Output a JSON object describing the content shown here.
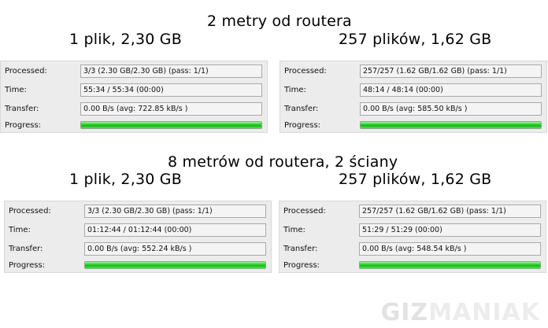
{
  "section_top": {
    "title": "2 metry od routera",
    "left": {
      "caption": "1 plik, 2,30 GB",
      "processed_label": "Processed:",
      "processed": "3/3 (2.30 GB/2.30 GB) (pass: 1/1)",
      "time_label": "Time:",
      "time": "55:34 / 55:34 (00:00)",
      "transfer_label": "Transfer:",
      "transfer": "0.00 B/s (avg: 722.85 kB/s )",
      "progress_label": "Progress:",
      "progress": 1.0
    },
    "right": {
      "caption": "257 plików, 1,62 GB",
      "processed_label": "Processed:",
      "processed": "257/257 (1.62 GB/1.62 GB) (pass: 1/1)",
      "time_label": "Time:",
      "time": "48:14 / 48:14 (00:00)",
      "transfer_label": "Transfer:",
      "transfer": "0.00 B/s (avg: 585.50 kB/s )",
      "progress_label": "Progress:",
      "progress": 1.0
    }
  },
  "section_bottom": {
    "title": "8 metrów od routera, 2 ściany",
    "left": {
      "caption": "1 plik, 2,30 GB",
      "processed_label": "Processed:",
      "processed": "3/3 (2.30 GB/2.30 GB) (pass: 1/1)",
      "time_label": "Time:",
      "time": "01:12:44 / 01:12:44 (00:00)",
      "transfer_label": "Transfer:",
      "transfer": "0.00 B/s (avg: 552.24 kB/s )",
      "progress_label": "Progress:",
      "progress": 1.0
    },
    "right": {
      "caption": "257 plików, 1,62 GB",
      "processed_label": "Processed:",
      "processed": "257/257 (1.62 GB/1.62 GB) (pass: 1/1)",
      "time_label": "Time:",
      "time": "51:29 / 51:29 (00:00)",
      "transfer_label": "Transfer:",
      "transfer": "0.00 B/s (avg: 548.54 kB/s )",
      "progress_label": "Progress:",
      "progress": 1.0
    }
  },
  "watermark": {
    "part1": "GIZ",
    "part2": "MANIAK"
  },
  "colors": {
    "progress_fill": "#22c722",
    "panel_bg": "#ececec",
    "field_border": "#a9a9a9"
  }
}
